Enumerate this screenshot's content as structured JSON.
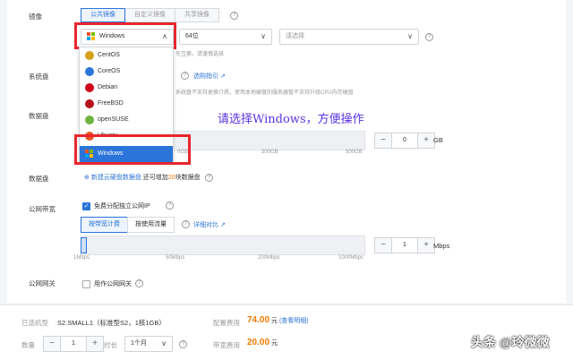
{
  "image": {
    "label": "镜像",
    "tabs": [
      "公共镜像",
      "自定义镜像",
      "共享镜像"
    ],
    "os_selected": "Windows",
    "version_selected": "64位",
    "detail_placeholder": "请选择",
    "hint_partial": "先互换，请谨慎选择"
  },
  "os_options": [
    {
      "label": "CentOS",
      "color": "#d4a017"
    },
    {
      "label": "CoreOS",
      "color": "#2b74d9"
    },
    {
      "label": "Debian",
      "color": "#d0021b"
    },
    {
      "label": "FreeBSD",
      "color": "#b5121b"
    },
    {
      "label": "openSUSE",
      "color": "#6db33f"
    },
    {
      "label": "Ubuntu",
      "color": "#e95420"
    },
    {
      "label": "Windows",
      "color": "#2b74d9"
    }
  ],
  "system_disk": {
    "label": "系统盘",
    "guide_link": "选购指引",
    "note_partial": "系统盘不支持更换介质，使用本地硬盘的服务器暂不支持升级CPU内存硬盘"
  },
  "data_disk": {
    "label": "数据盘",
    "ticks": [
      "0GB",
      "300GB",
      "500GB"
    ],
    "value": "0",
    "unit": "GB",
    "minus": "−",
    "plus": "+"
  },
  "annotation": "请选择Windows，方便操作",
  "data_disk2": {
    "label": "数据盘",
    "add_link": "新建云硬盘数据盘",
    "remaining_prefix": "还可增加",
    "remaining_count": "20",
    "remaining_suffix": "块数据盘"
  },
  "bandwidth": {
    "label": "公网带宽",
    "free_ip": "免费分配独立公网IP",
    "options": [
      "按带宽计费",
      "按使用流量"
    ],
    "detail_link": "详细对比",
    "ticks": [
      "1Mbps",
      "50Mbps",
      "200Mbps",
      "1000Mbps"
    ],
    "value": "1",
    "unit": "Mbps",
    "minus": "−",
    "plus": "+"
  },
  "gateway": {
    "label": "公网网关",
    "checkbox_label": "用作公网网关"
  },
  "summary": {
    "model_label": "已选机型",
    "model_value": "S2.SMALL1（标准型S2，1核1GB）",
    "config_fee_label": "配置费用",
    "config_fee": "74.00",
    "config_unit": "元",
    "config_detail": "(查看明细)",
    "quantity_label": "数量",
    "quantity": "1",
    "duration_label": "时长",
    "duration": "1个月",
    "bandwidth_fee_label": "带宽费用",
    "bandwidth_fee": "20.00",
    "bandwidth_unit": "元"
  },
  "watermark": "头条 @玲微微",
  "colors": {
    "accent": "#2b74d9",
    "highlight": "#e8262d",
    "annotation": "#5a32e6",
    "price": "#f07900"
  }
}
